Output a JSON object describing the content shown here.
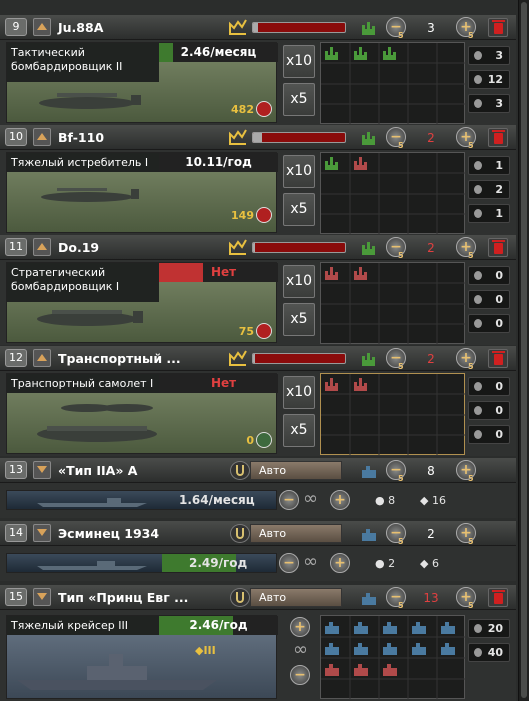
{
  "rows": [
    {
      "num": "9",
      "name": "Ju.88A",
      "card_label": "Тактический бомбардировщик II",
      "rate": "2.46/месяц",
      "stock": "482",
      "count": "3",
      "count_color": "#ffffff",
      "strength": 0.05,
      "x1": "x10",
      "x2": "x5",
      "eq": [
        "3",
        "12",
        "3"
      ]
    },
    {
      "num": "10",
      "name": "Bf-110",
      "card_label": "Тяжелый истребитель I",
      "rate": "10.11/год",
      "stock": "149",
      "count": "2",
      "count_color": "#e04040",
      "strength": 0.1,
      "x1": "x10",
      "x2": "x5",
      "eq": [
        "1",
        "2",
        "1"
      ]
    },
    {
      "num": "11",
      "name": "Do.19",
      "card_label": "Стратегический бомбардировщик I",
      "rate": "Нет",
      "stock": "75",
      "count": "2",
      "count_color": "#e04040",
      "strength": 0.02,
      "x1": "x10",
      "x2": "x5",
      "eq": [
        "0",
        "0",
        "0"
      ]
    },
    {
      "num": "12",
      "name": "Транспортный ...",
      "card_label": "Транспортный самолет I",
      "rate": "Нет",
      "stock": "0",
      "count": "2",
      "count_color": "#e04040",
      "strength": 0.02,
      "x1": "x10",
      "x2": "x5",
      "eq": [
        "0",
        "0",
        "0"
      ]
    }
  ],
  "naval": [
    {
      "num": "13",
      "name": "«Тип IIA» А",
      "mode": "Авто",
      "rate": "1.64/месяц",
      "count": "8",
      "count_color": "#ffffff",
      "fuel": "8",
      "steel": "16"
    },
    {
      "num": "14",
      "name": "Эсминец 1934",
      "mode": "Авто",
      "rate": "2.49/год",
      "count": "2",
      "count_color": "#ffffff",
      "fuel": "2",
      "steel": "6"
    },
    {
      "num": "15",
      "name": "Тип «Принц Евг ...",
      "mode": "Авто",
      "card_label": "Тяжелый крейсер III",
      "rate": "2.46/год",
      "count": "13",
      "count_color": "#e04040",
      "eq": [
        "20",
        "40"
      ]
    }
  ],
  "sub5": "5",
  "infinity": "∞",
  "plus": "+",
  "minus": "−",
  "icons": {
    "trash": "trash-icon",
    "growth": "growth-icon",
    "anchor": "anchor-icon"
  },
  "colors": {
    "red": "#e04040",
    "gold": "#e8c040",
    "green": "#3e7a2e"
  }
}
